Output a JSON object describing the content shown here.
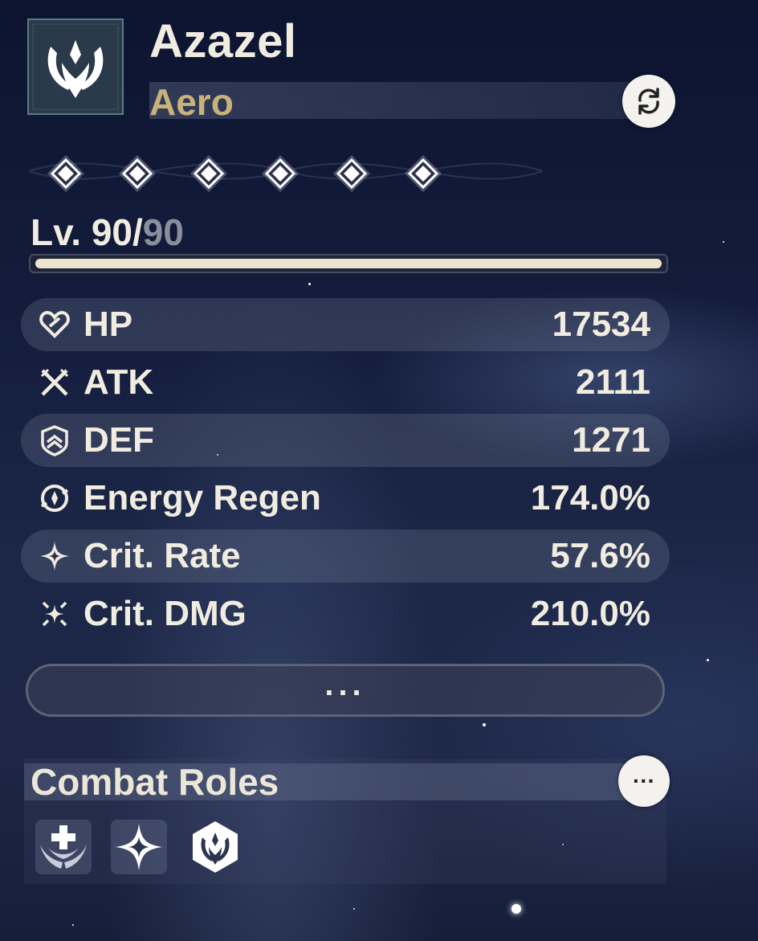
{
  "character": {
    "name": "Azazel",
    "element": "Aero",
    "emblem_icon": "aero-emblem-icon",
    "swap_icon": "refresh-swap-icon"
  },
  "sequence": {
    "nodes": 6,
    "unlocked": 6
  },
  "level": {
    "prefix": "Lv. ",
    "current": "90",
    "separator": "/",
    "max": "90",
    "progress": 1.0
  },
  "stats": [
    {
      "label": "HP",
      "value": "17534",
      "icon": "heart-icon"
    },
    {
      "label": "ATK",
      "value": "2111",
      "icon": "crossed-swords-icon"
    },
    {
      "label": "DEF",
      "value": "1271",
      "icon": "shield-icon"
    },
    {
      "label": "Energy Regen",
      "value": "174.0%",
      "icon": "energy-regen-icon"
    },
    {
      "label": "Crit. Rate",
      "value": "57.6%",
      "icon": "crit-rate-star-icon"
    },
    {
      "label": "Crit. DMG",
      "value": "210.0%",
      "icon": "crit-dmg-stars-icon"
    }
  ],
  "more_button": {
    "label": "..."
  },
  "combat_roles": {
    "title": "Combat Roles",
    "more_label": "···",
    "roles": [
      {
        "icon": "healer-wings-icon"
      },
      {
        "icon": "four-point-star-icon"
      },
      {
        "icon": "aero-hexagon-icon"
      }
    ]
  },
  "colors": {
    "accent_gold": "#c9b27a",
    "text": "#f1ece0",
    "level_bar": "#ece4cd"
  }
}
